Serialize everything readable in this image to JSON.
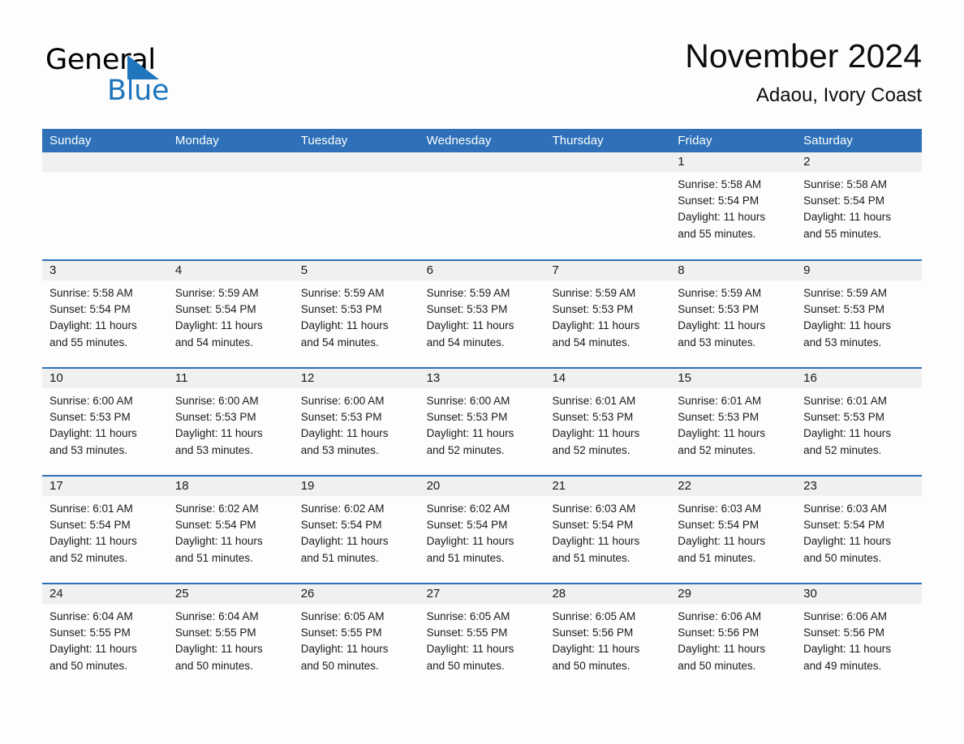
{
  "logo": {
    "word1": "General",
    "word2": "Blue",
    "triangle_color": "#1f76bc",
    "icon": "triangle-logo-icon"
  },
  "header": {
    "title": "November 2024",
    "subtitle": "Adaou, Ivory Coast"
  },
  "colors": {
    "header_blue": "#2e71b8",
    "day_band_gray": "#f0f0f0",
    "page_background": "#fdfdfd",
    "text": "#1a1a1a"
  },
  "weekdays": [
    "Sunday",
    "Monday",
    "Tuesday",
    "Wednesday",
    "Thursday",
    "Friday",
    "Saturday"
  ],
  "weeks": [
    [
      {
        "day": "",
        "lines": []
      },
      {
        "day": "",
        "lines": []
      },
      {
        "day": "",
        "lines": []
      },
      {
        "day": "",
        "lines": []
      },
      {
        "day": "",
        "lines": []
      },
      {
        "day": "1",
        "lines": [
          "Sunrise: 5:58 AM",
          "Sunset: 5:54 PM",
          "Daylight: 11 hours",
          "and 55 minutes."
        ]
      },
      {
        "day": "2",
        "lines": [
          "Sunrise: 5:58 AM",
          "Sunset: 5:54 PM",
          "Daylight: 11 hours",
          "and 55 minutes."
        ]
      }
    ],
    [
      {
        "day": "3",
        "lines": [
          "Sunrise: 5:58 AM",
          "Sunset: 5:54 PM",
          "Daylight: 11 hours",
          "and 55 minutes."
        ]
      },
      {
        "day": "4",
        "lines": [
          "Sunrise: 5:59 AM",
          "Sunset: 5:54 PM",
          "Daylight: 11 hours",
          "and 54 minutes."
        ]
      },
      {
        "day": "5",
        "lines": [
          "Sunrise: 5:59 AM",
          "Sunset: 5:53 PM",
          "Daylight: 11 hours",
          "and 54 minutes."
        ]
      },
      {
        "day": "6",
        "lines": [
          "Sunrise: 5:59 AM",
          "Sunset: 5:53 PM",
          "Daylight: 11 hours",
          "and 54 minutes."
        ]
      },
      {
        "day": "7",
        "lines": [
          "Sunrise: 5:59 AM",
          "Sunset: 5:53 PM",
          "Daylight: 11 hours",
          "and 54 minutes."
        ]
      },
      {
        "day": "8",
        "lines": [
          "Sunrise: 5:59 AM",
          "Sunset: 5:53 PM",
          "Daylight: 11 hours",
          "and 53 minutes."
        ]
      },
      {
        "day": "9",
        "lines": [
          "Sunrise: 5:59 AM",
          "Sunset: 5:53 PM",
          "Daylight: 11 hours",
          "and 53 minutes."
        ]
      }
    ],
    [
      {
        "day": "10",
        "lines": [
          "Sunrise: 6:00 AM",
          "Sunset: 5:53 PM",
          "Daylight: 11 hours",
          "and 53 minutes."
        ]
      },
      {
        "day": "11",
        "lines": [
          "Sunrise: 6:00 AM",
          "Sunset: 5:53 PM",
          "Daylight: 11 hours",
          "and 53 minutes."
        ]
      },
      {
        "day": "12",
        "lines": [
          "Sunrise: 6:00 AM",
          "Sunset: 5:53 PM",
          "Daylight: 11 hours",
          "and 53 minutes."
        ]
      },
      {
        "day": "13",
        "lines": [
          "Sunrise: 6:00 AM",
          "Sunset: 5:53 PM",
          "Daylight: 11 hours",
          "and 52 minutes."
        ]
      },
      {
        "day": "14",
        "lines": [
          "Sunrise: 6:01 AM",
          "Sunset: 5:53 PM",
          "Daylight: 11 hours",
          "and 52 minutes."
        ]
      },
      {
        "day": "15",
        "lines": [
          "Sunrise: 6:01 AM",
          "Sunset: 5:53 PM",
          "Daylight: 11 hours",
          "and 52 minutes."
        ]
      },
      {
        "day": "16",
        "lines": [
          "Sunrise: 6:01 AM",
          "Sunset: 5:53 PM",
          "Daylight: 11 hours",
          "and 52 minutes."
        ]
      }
    ],
    [
      {
        "day": "17",
        "lines": [
          "Sunrise: 6:01 AM",
          "Sunset: 5:54 PM",
          "Daylight: 11 hours",
          "and 52 minutes."
        ]
      },
      {
        "day": "18",
        "lines": [
          "Sunrise: 6:02 AM",
          "Sunset: 5:54 PM",
          "Daylight: 11 hours",
          "and 51 minutes."
        ]
      },
      {
        "day": "19",
        "lines": [
          "Sunrise: 6:02 AM",
          "Sunset: 5:54 PM",
          "Daylight: 11 hours",
          "and 51 minutes."
        ]
      },
      {
        "day": "20",
        "lines": [
          "Sunrise: 6:02 AM",
          "Sunset: 5:54 PM",
          "Daylight: 11 hours",
          "and 51 minutes."
        ]
      },
      {
        "day": "21",
        "lines": [
          "Sunrise: 6:03 AM",
          "Sunset: 5:54 PM",
          "Daylight: 11 hours",
          "and 51 minutes."
        ]
      },
      {
        "day": "22",
        "lines": [
          "Sunrise: 6:03 AM",
          "Sunset: 5:54 PM",
          "Daylight: 11 hours",
          "and 51 minutes."
        ]
      },
      {
        "day": "23",
        "lines": [
          "Sunrise: 6:03 AM",
          "Sunset: 5:54 PM",
          "Daylight: 11 hours",
          "and 50 minutes."
        ]
      }
    ],
    [
      {
        "day": "24",
        "lines": [
          "Sunrise: 6:04 AM",
          "Sunset: 5:55 PM",
          "Daylight: 11 hours",
          "and 50 minutes."
        ]
      },
      {
        "day": "25",
        "lines": [
          "Sunrise: 6:04 AM",
          "Sunset: 5:55 PM",
          "Daylight: 11 hours",
          "and 50 minutes."
        ]
      },
      {
        "day": "26",
        "lines": [
          "Sunrise: 6:05 AM",
          "Sunset: 5:55 PM",
          "Daylight: 11 hours",
          "and 50 minutes."
        ]
      },
      {
        "day": "27",
        "lines": [
          "Sunrise: 6:05 AM",
          "Sunset: 5:55 PM",
          "Daylight: 11 hours",
          "and 50 minutes."
        ]
      },
      {
        "day": "28",
        "lines": [
          "Sunrise: 6:05 AM",
          "Sunset: 5:56 PM",
          "Daylight: 11 hours",
          "and 50 minutes."
        ]
      },
      {
        "day": "29",
        "lines": [
          "Sunrise: 6:06 AM",
          "Sunset: 5:56 PM",
          "Daylight: 11 hours",
          "and 50 minutes."
        ]
      },
      {
        "day": "30",
        "lines": [
          "Sunrise: 6:06 AM",
          "Sunset: 5:56 PM",
          "Daylight: 11 hours",
          "and 49 minutes."
        ]
      }
    ]
  ]
}
